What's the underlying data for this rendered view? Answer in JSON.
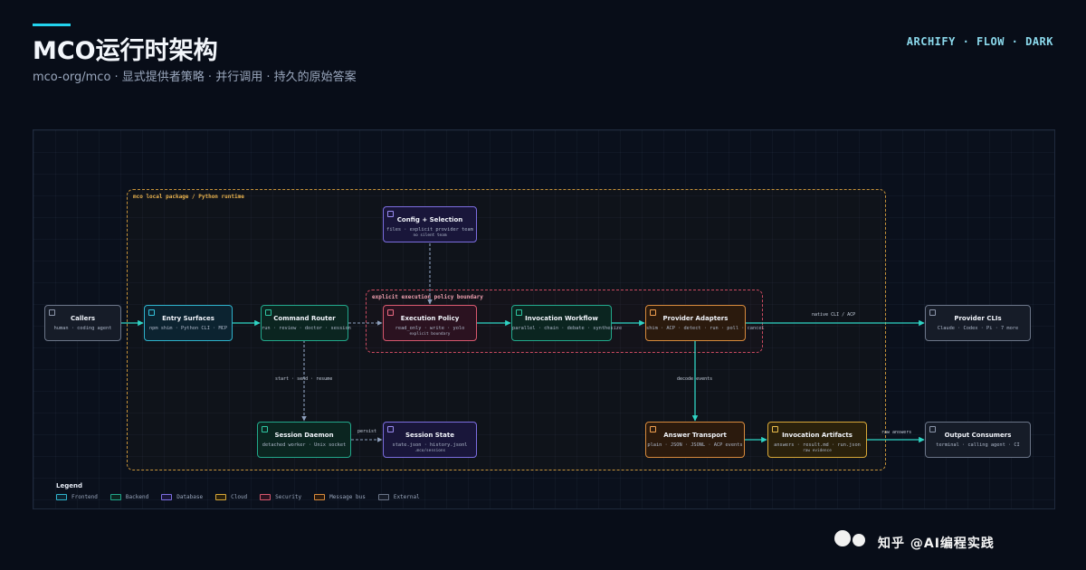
{
  "header": {
    "title": "MCO运行时架构",
    "subtitle": "mco-org/mco · 显式提供者策略 · 并行调用 · 持久的原始答案",
    "brand": "ARCHIFY · FLOW · DARK"
  },
  "groups": {
    "package": "mco local package / Python runtime",
    "policy": "explicit execution policy boundary"
  },
  "nodes": {
    "callers": {
      "title": "Callers",
      "sub": "human · coding agent"
    },
    "entry": {
      "title": "Entry Surfaces",
      "sub": "npm shim · Python CLI · MCP"
    },
    "router": {
      "title": "Command Router",
      "sub": "run · review · doctor · session"
    },
    "config": {
      "title": "Config + Selection",
      "sub": "files · explicit provider team",
      "sub2": "no silent team"
    },
    "policy": {
      "title": "Execution Policy",
      "sub": "read_only · write · yolo",
      "sub2": "explicit boundary"
    },
    "workflow": {
      "title": "Invocation Workflow",
      "sub": "parallel · chain · debate · synthesize"
    },
    "adapters": {
      "title": "Provider Adapters",
      "sub": "shim · ACP · detect · run · poll · cancel"
    },
    "providers": {
      "title": "Provider CLIs",
      "sub": "Claude · Codex · Pi · 7 more"
    },
    "daemon": {
      "title": "Session Daemon",
      "sub": "detached worker · Unix socket"
    },
    "state": {
      "title": "Session State",
      "sub": "state.json · history.jsonl",
      "sub2": ".mco/sessions"
    },
    "transport": {
      "title": "Answer Transport",
      "sub": "plain · JSON · JSONL · ACP events"
    },
    "artifacts": {
      "title": "Invocation Artifacts",
      "sub": "answers · result.md · run.json",
      "sub2": "raw evidence"
    },
    "consumers": {
      "title": "Output Consumers",
      "sub": "terminal · calling agent · CI"
    }
  },
  "edge_labels": {
    "native": "native CLI / ACP",
    "session": "start · send · resume",
    "persist": "persist",
    "decode": "decode events",
    "raw": "raw answers"
  },
  "legend": {
    "title": "Legend",
    "items": [
      {
        "label": "Frontend",
        "color": "#2fb3cc"
      },
      {
        "label": "Backend",
        "color": "#22a88b"
      },
      {
        "label": "Database",
        "color": "#7c6ee0"
      },
      {
        "label": "Cloud",
        "color": "#d8a838"
      },
      {
        "label": "Security",
        "color": "#d8586e"
      },
      {
        "label": "Message bus",
        "color": "#d78a3c"
      },
      {
        "label": "External",
        "color": "#6b7588"
      }
    ]
  },
  "colors": {
    "accent": "#22d3ee",
    "edge_solid": "#2fd4c4",
    "edge_dashed": "#8ea0bd"
  },
  "watermark": "知乎 @AI编程实践"
}
